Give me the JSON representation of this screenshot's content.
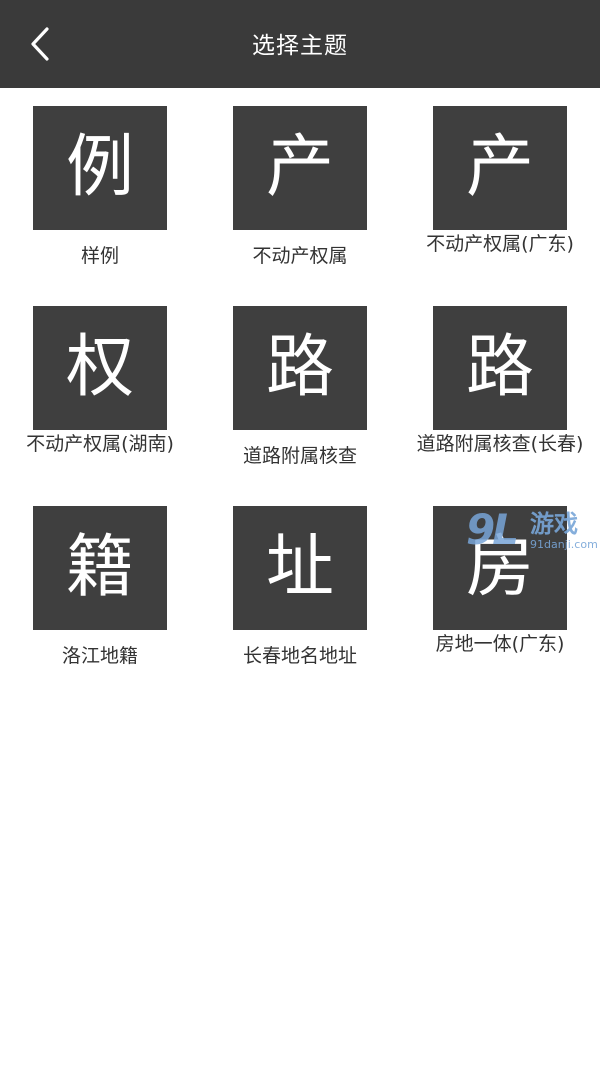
{
  "header": {
    "title": "选择主题",
    "back_icon": "chevron-left-icon"
  },
  "themes": [
    {
      "glyph": "例",
      "label": "样例"
    },
    {
      "glyph": "产",
      "label": "不动产权属"
    },
    {
      "glyph": "产",
      "label": "不动产权属(广东)"
    },
    {
      "glyph": "权",
      "label": "不动产权属(湖南)"
    },
    {
      "glyph": "路",
      "label": "道路附属核查"
    },
    {
      "glyph": "路",
      "label": "道路附属核查(长春)"
    },
    {
      "glyph": "籍",
      "label": "洛江地籍"
    },
    {
      "glyph": "址",
      "label": "长春地名地址"
    },
    {
      "glyph": "房",
      "label": "房地一体(广东)"
    }
  ],
  "watermark": {
    "logo": "9L",
    "text": "游戏",
    "url": "91danji.com"
  },
  "colors": {
    "header_bg": "#3a3a3a",
    "tile_bg": "#3f3f3f",
    "label_text": "#333333"
  }
}
